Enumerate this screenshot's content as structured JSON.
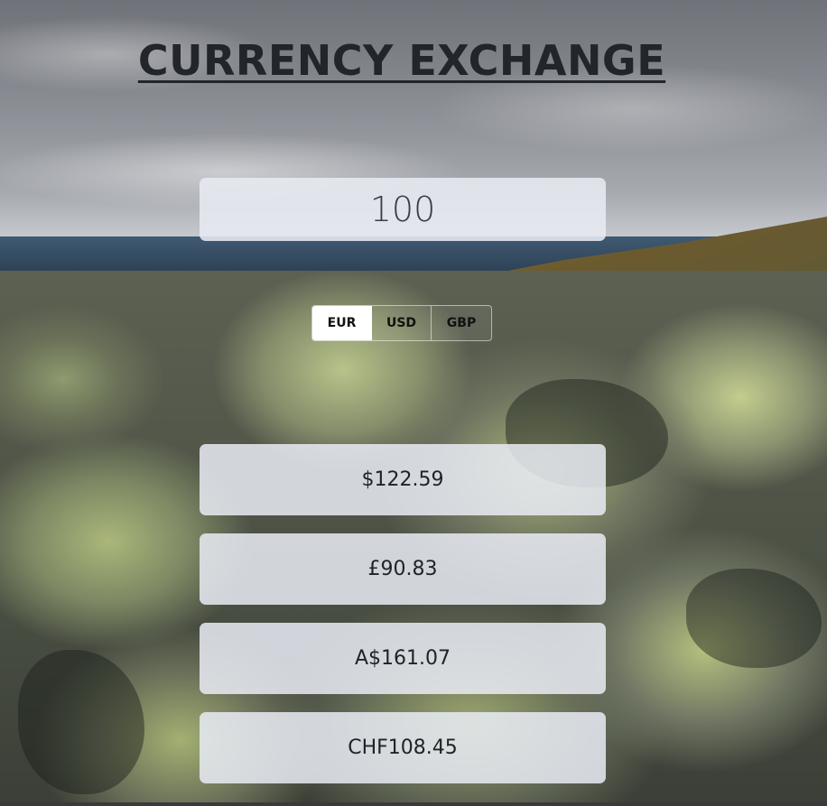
{
  "header": {
    "title": "CURRENCY EXCHANGE"
  },
  "converter": {
    "amount": "100",
    "currencies": [
      {
        "code": "EUR",
        "active": true
      },
      {
        "code": "USD",
        "active": false
      },
      {
        "code": "GBP",
        "active": false
      }
    ]
  },
  "results": [
    {
      "value": "$122.59"
    },
    {
      "value": "£90.83"
    },
    {
      "value": "A$161.07"
    },
    {
      "value": "CHF108.45"
    }
  ],
  "colors": {
    "title": "#222529",
    "card_background": "#e8ebf3",
    "active_toggle": "#ffffff"
  }
}
